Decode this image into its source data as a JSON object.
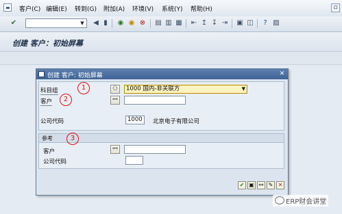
{
  "menubar": {
    "items": [
      "客户(C)",
      "编辑(E)",
      "转到(G)",
      "附加(A)",
      "环境(V)",
      "系统(Y)",
      "帮助(H)"
    ]
  },
  "toolbar": {
    "command_field_value": "",
    "icons": [
      "enter-icon",
      "dropdown-icon",
      "back-arrow-icon",
      "save-icon",
      "back-icon",
      "exit-icon",
      "cancel-icon",
      "print-icon",
      "find-icon",
      "find-next-icon",
      "first-page-icon",
      "prev-page-icon",
      "next-page-icon",
      "last-page-icon",
      "new-session-icon",
      "shortcut-icon",
      "help-icon",
      "layout-icon"
    ]
  },
  "screen": {
    "title": "创建 客户：初始屏幕"
  },
  "dialog": {
    "title": "创建 客户: 初始屏幕",
    "account_group_label": "科目组",
    "account_group_value": "1000 国内-非关联方",
    "customer_label": "客户",
    "customer_value": "",
    "company_code_label": "公司代码",
    "company_code_value": "1000",
    "company_name": "北京电子有限公司",
    "reference_section_title": "参考",
    "ref_customer_label": "客户",
    "ref_customer_value": "",
    "ref_company_code_label": "公司代码",
    "ref_company_code_value": "",
    "annotations": [
      "1",
      "2",
      "3"
    ]
  },
  "watermark": {
    "text": "ERP财会讲堂"
  }
}
